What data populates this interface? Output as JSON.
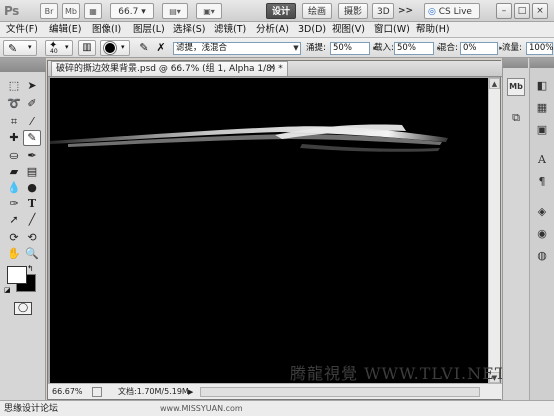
{
  "app_bar": {
    "logo": "Ps",
    "bridge": "Br",
    "mini_bridge": "Mb",
    "zoom": "66.7",
    "workspaces": [
      "设计",
      "绘画",
      "摄影",
      "3D"
    ],
    "more": ">>",
    "cs_live": "CS Live",
    "window_buttons": [
      "–",
      "□",
      "×"
    ]
  },
  "menu": {
    "items": [
      "文件(F)",
      "编辑(E)",
      "图像(I)",
      "图层(L)",
      "选择(S)",
      "滤镜(T)",
      "分析(A)",
      "3D(D)",
      "视图(V)",
      "窗口(W)",
      "帮助(H)"
    ]
  },
  "options_bar": {
    "brush_size": "40",
    "blend_mode": "滤提，浅混合",
    "opacity_label": "涌提:",
    "opacity_value": "50%",
    "flow_label": "载入:",
    "flow_value": "50%",
    "mix_label": "混合:",
    "mix_value": "0%",
    "flow2_label": "流量:",
    "flow2_value": "100%"
  },
  "document": {
    "tab_title": "破碎的撕边效果背景.psd @ 66.7% (组 1, Alpha 1/8) *",
    "close": "×",
    "zoom_status": "66.67%",
    "doc_size": "文档:1.70M/5.19M"
  },
  "watermark": "腾龍視覺 WWW.TLVI.NET",
  "footer": {
    "left": "思缘设计论坛",
    "center": "www.MISSYUAN.com"
  },
  "toolbox_icons": [
    "move-icon",
    "marquee-icon",
    "lasso-icon",
    "quick-select-icon",
    "crop-icon",
    "eyedropper-icon",
    "healing-icon",
    "mixer-brush-icon",
    "stamp-icon",
    "history-brush-icon",
    "eraser-icon",
    "gradient-icon",
    "blur-icon",
    "dodge-icon",
    "pen-icon",
    "type-icon",
    "path-select-icon",
    "line-icon",
    "3d-rotate-icon",
    "3d-orbit-icon",
    "hand-icon",
    "zoom-icon"
  ],
  "colors": {
    "foreground": "#ffffff",
    "background": "#000000",
    "canvas": "#000000",
    "active_workspace": "#555555"
  }
}
